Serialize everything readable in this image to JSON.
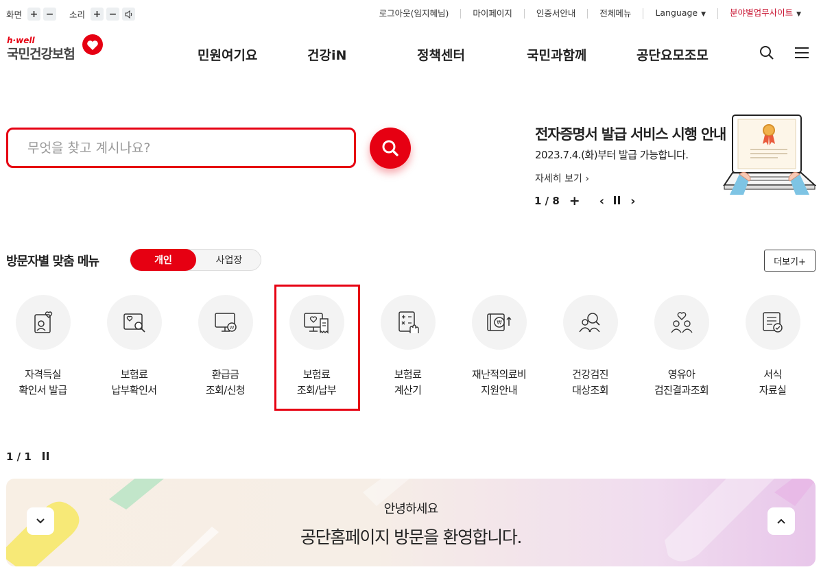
{
  "util": {
    "screen_label": "화면",
    "sound_label": "소리",
    "plus": "+",
    "minus": "−"
  },
  "top_links": [
    {
      "label": "로그아웃(임지혜님)"
    },
    {
      "label": "마이페이지"
    },
    {
      "label": "인증서안내"
    },
    {
      "label": "전체메뉴"
    },
    {
      "label": "Language"
    },
    {
      "label": "분야별업무사이트"
    }
  ],
  "logo": {
    "tagline": "h·well",
    "name": "국민건강보험"
  },
  "gnb": [
    "민원여기요",
    "건강iN",
    "정책센터",
    "국민과함께",
    "공단요모조모"
  ],
  "search": {
    "placeholder": "무엇을 찾고 계시나요?"
  },
  "banner": {
    "title": "전자증명서 발급 서비스 시행 안내",
    "subtitle": "2023.7.4.(화)부터 발급 가능합니다.",
    "more": "자세히 보기",
    "page": "1 / 8"
  },
  "visitor_menu": {
    "title": "방문자별 맞춤 메뉴",
    "tab_personal": "개인",
    "tab_business": "사업장",
    "more": "더보기+",
    "items": [
      {
        "l1": "자격득실",
        "l2": "확인서 발급",
        "icon": "id-card-heart-icon"
      },
      {
        "l1": "보험료",
        "l2": "납부확인서",
        "icon": "document-search-icon"
      },
      {
        "l1": "환급금",
        "l2": "조회/신청",
        "icon": "monitor-won-icon"
      },
      {
        "l1": "보험료",
        "l2": "조회/납부",
        "icon": "monitor-receipt-icon"
      },
      {
        "l1": "보험료",
        "l2": "계산기",
        "icon": "calculator-hand-icon"
      },
      {
        "l1": "재난적의료비",
        "l2": "지원안내",
        "icon": "coin-up-icon"
      },
      {
        "l1": "건강검진",
        "l2": "대상조회",
        "icon": "people-search-icon"
      },
      {
        "l1": "영유아",
        "l2": "검진결과조회",
        "icon": "family-heart-icon"
      },
      {
        "l1": "서식",
        "l2": "자료실",
        "icon": "form-check-icon"
      }
    ],
    "page": "1 / 1"
  },
  "welcome": {
    "hello": "안녕하세요",
    "message": "공단홈페이지 방문을 환영합니다."
  },
  "colors": {
    "accent": "#e60012",
    "link_red": "#c8102e"
  }
}
